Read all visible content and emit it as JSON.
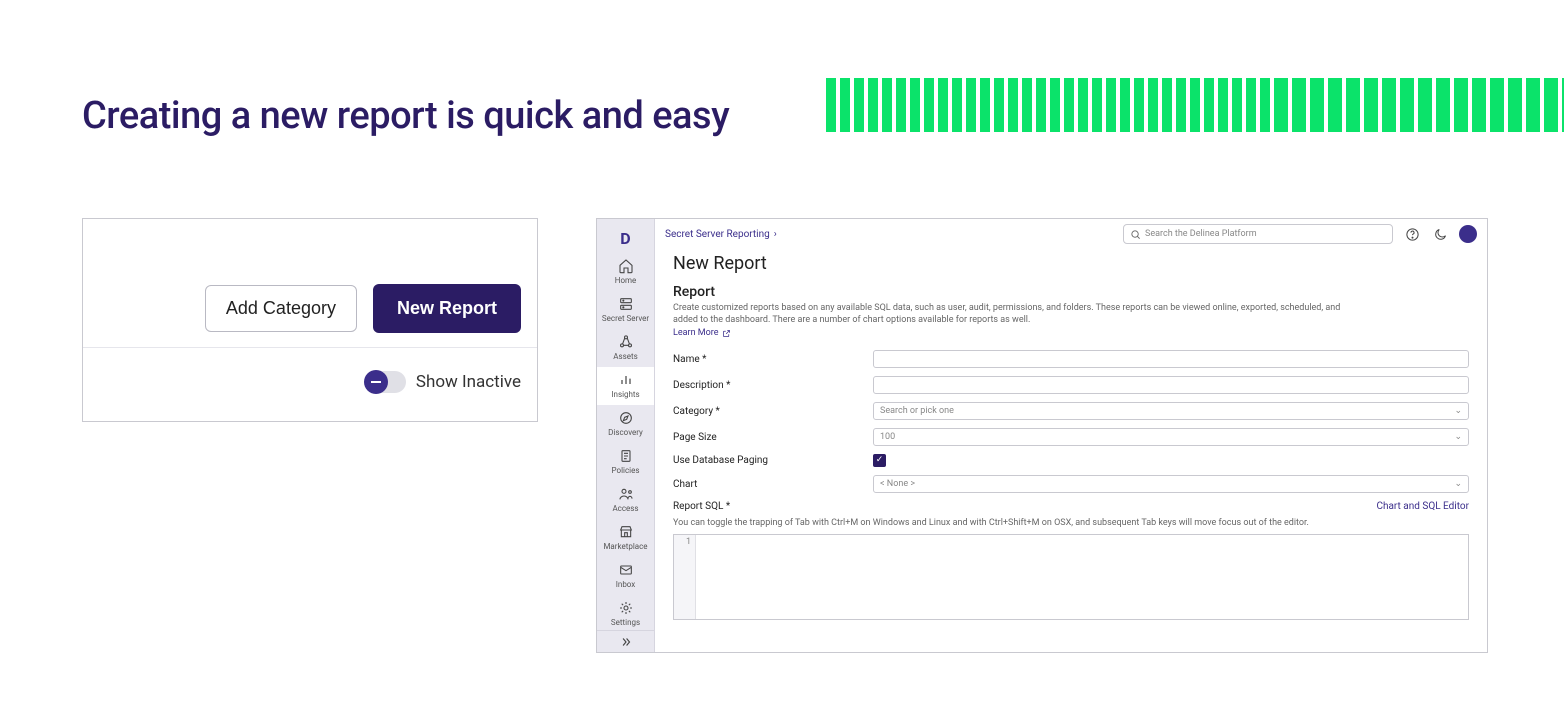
{
  "heading": "Creating a new report is quick and easy",
  "left_panel": {
    "add_category_label": "Add Category",
    "new_report_label": "New Report",
    "show_inactive_label": "Show Inactive"
  },
  "app": {
    "breadcrumb": "Secret Server Reporting",
    "search_placeholder": "Search the Delinea Platform",
    "sidebar": {
      "items": [
        {
          "label": "Home"
        },
        {
          "label": "Secret Server"
        },
        {
          "label": "Assets"
        },
        {
          "label": "Insights"
        },
        {
          "label": "Discovery"
        },
        {
          "label": "Policies"
        },
        {
          "label": "Access"
        },
        {
          "label": "Marketplace"
        },
        {
          "label": "Inbox"
        },
        {
          "label": "Settings"
        }
      ]
    },
    "page_title": "New Report",
    "section": {
      "head": "Report",
      "desc": "Create customized reports based on any available SQL data, such as user, audit, permissions, and folders. These reports can be viewed online, exported, scheduled, and added to the dashboard. There are a number of chart options available for reports as well.",
      "learn_more": "Learn More"
    },
    "form": {
      "name_label": "Name *",
      "description_label": "Description *",
      "category_label": "Category *",
      "category_placeholder": "Search or pick one",
      "page_size_label": "Page Size",
      "page_size_value": "100",
      "use_paging_label": "Use Database Paging",
      "chart_label": "Chart",
      "chart_value": "< None >",
      "sql_label": "Report SQL *",
      "sql_link": "Chart and SQL Editor",
      "hint": "You can toggle the trapping of Tab with Ctrl+M on Windows and Linux and with Ctrl+Shift+M on OSX, and subsequent Tab keys will move focus out of the editor.",
      "gutter_1": "1"
    }
  }
}
